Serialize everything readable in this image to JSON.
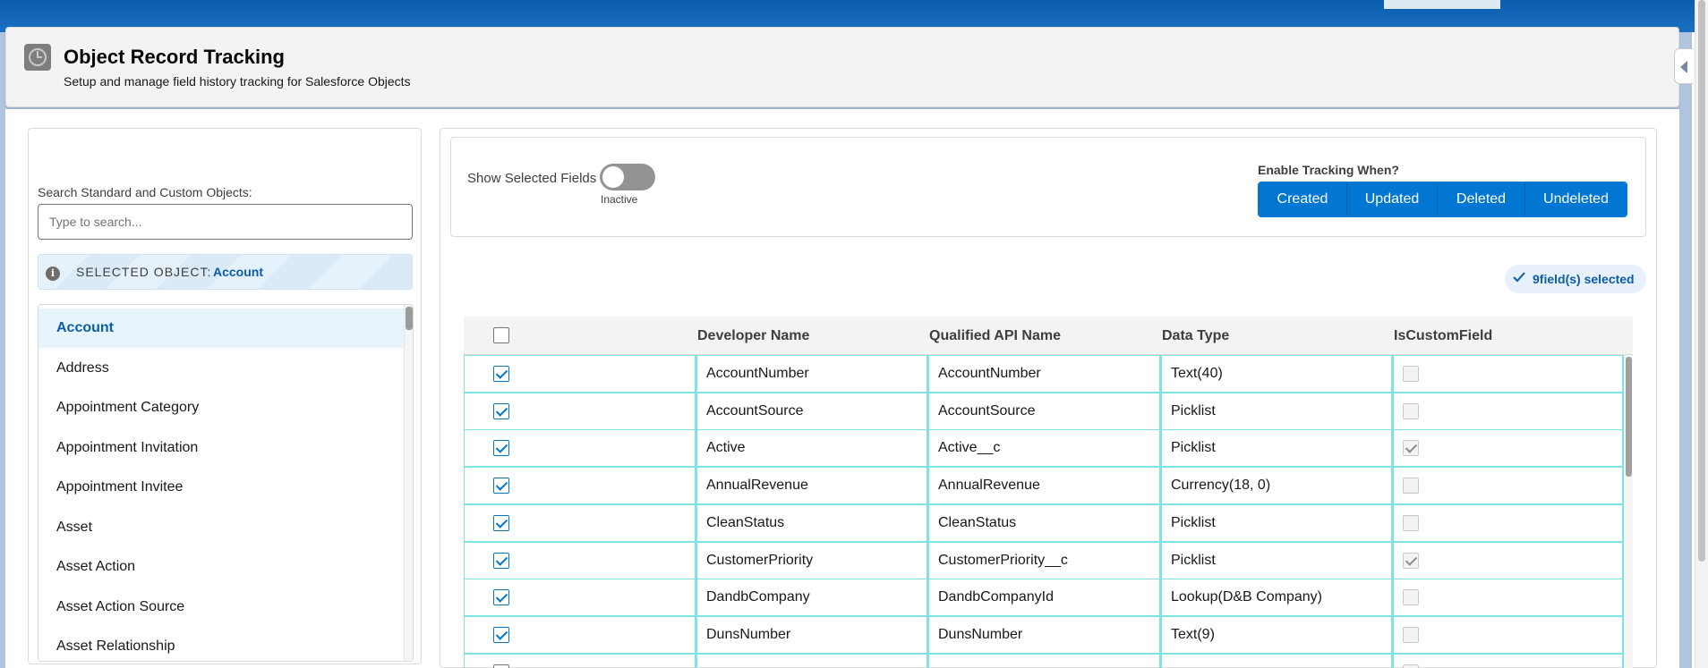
{
  "header": {
    "title": "Object Record Tracking",
    "subtitle": "Setup and manage field history tracking for Salesforce Objects",
    "icon": "clock-icon"
  },
  "left": {
    "search_label": "Search Standard and Custom Objects:",
    "search_placeholder": "Type to search...",
    "search_value": "",
    "selected_label": "SELECTED OBJECT:",
    "selected_value": "Account",
    "objects": [
      "Account",
      "Address",
      "Appointment Category",
      "Appointment Invitation",
      "Appointment Invitee",
      "Asset",
      "Asset Action",
      "Asset Action Source",
      "Asset Relationship"
    ],
    "active_object": "Account"
  },
  "controls": {
    "show_selected_label": "Show Selected Fields",
    "toggle_state": "Inactive",
    "enable_label": "Enable Tracking When?",
    "buttons": [
      "Created",
      "Updated",
      "Deleted",
      "Undeleted"
    ],
    "badge": "9field(s) selected"
  },
  "table": {
    "columns": [
      "Developer Name",
      "Qualified API Name",
      "Data Type",
      "IsCustomField"
    ],
    "rows": [
      {
        "selected": true,
        "developer_name": "AccountNumber",
        "api_name": "AccountNumber",
        "data_type": "Text(40)",
        "is_custom": false
      },
      {
        "selected": true,
        "developer_name": "AccountSource",
        "api_name": "AccountSource",
        "data_type": "Picklist",
        "is_custom": false
      },
      {
        "selected": true,
        "developer_name": "Active",
        "api_name": "Active__c",
        "data_type": "Picklist",
        "is_custom": true
      },
      {
        "selected": true,
        "developer_name": "AnnualRevenue",
        "api_name": "AnnualRevenue",
        "data_type": "Currency(18, 0)",
        "is_custom": false
      },
      {
        "selected": true,
        "developer_name": "CleanStatus",
        "api_name": "CleanStatus",
        "data_type": "Picklist",
        "is_custom": false
      },
      {
        "selected": true,
        "developer_name": "CustomerPriority",
        "api_name": "CustomerPriority__c",
        "data_type": "Picklist",
        "is_custom": true
      },
      {
        "selected": true,
        "developer_name": "DandbCompany",
        "api_name": "DandbCompanyId",
        "data_type": "Lookup(D&B Company)",
        "is_custom": false
      },
      {
        "selected": true,
        "developer_name": "DunsNumber",
        "api_name": "DunsNumber",
        "data_type": "Text(9)",
        "is_custom": false
      },
      {
        "selected": false,
        "developer_name": "",
        "api_name": "",
        "data_type": "",
        "is_custom": false
      }
    ]
  },
  "colors": {
    "brand": "#0176d3",
    "brand_dark": "#0b5cab",
    "row_border": "#7fe3e3"
  }
}
